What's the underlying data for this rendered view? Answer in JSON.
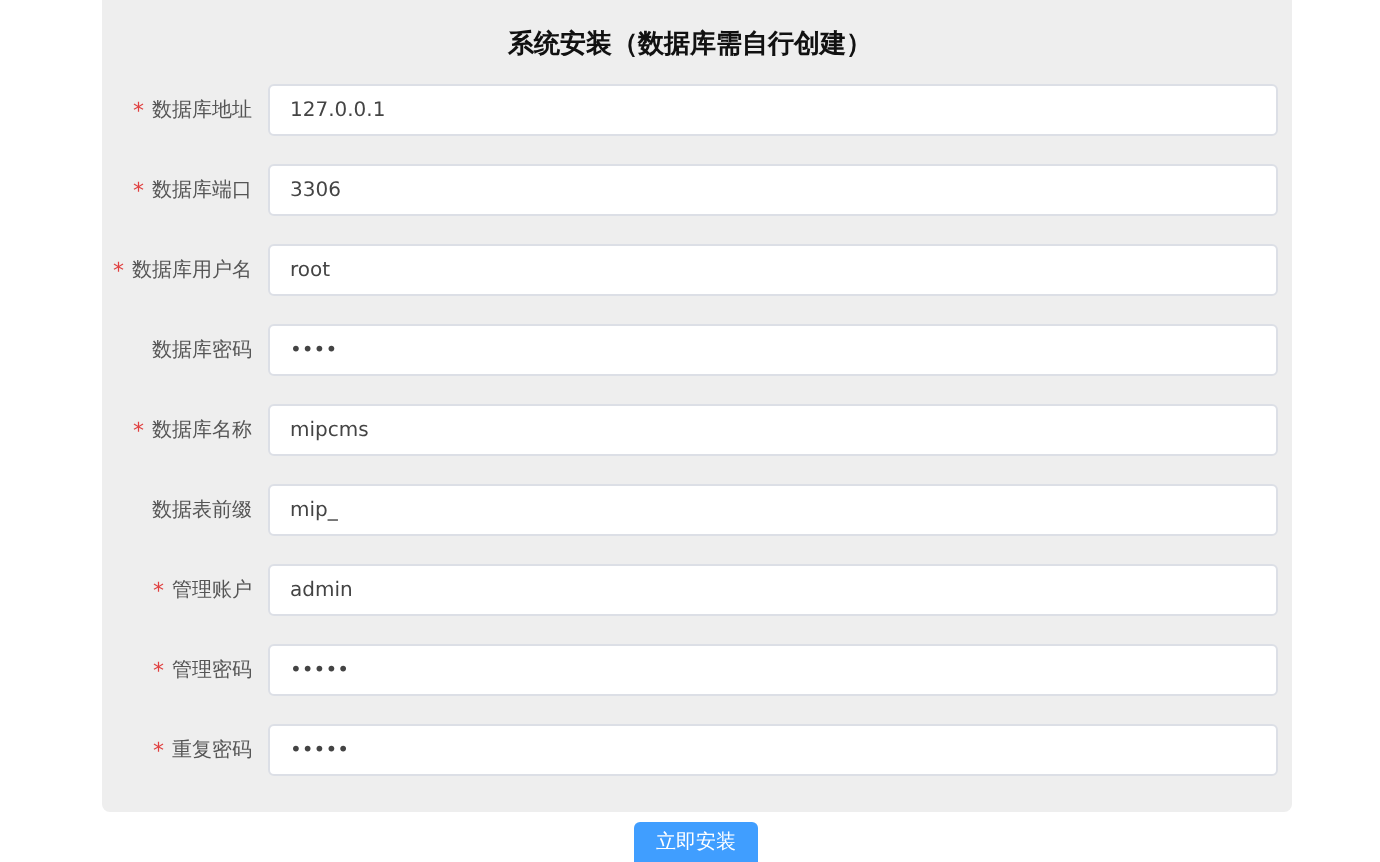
{
  "form": {
    "title": "系统安装（数据库需自行创建）",
    "required_mark": "*",
    "fields": [
      {
        "label": "数据库地址",
        "required": true,
        "value": "127.0.0.1"
      },
      {
        "label": "数据库端口",
        "required": true,
        "value": "3306"
      },
      {
        "label": "数据库用户名",
        "required": true,
        "value": "root"
      },
      {
        "label": "数据库密码",
        "required": false,
        "value": "••••"
      },
      {
        "label": "数据库名称",
        "required": true,
        "value": "mipcms"
      },
      {
        "label": "数据表前缀",
        "required": false,
        "value": "mip_"
      },
      {
        "label": "管理账户",
        "required": true,
        "value": "admin"
      },
      {
        "label": "管理密码",
        "required": true,
        "value": "•••••"
      },
      {
        "label": "重复密码",
        "required": true,
        "value": "•••••"
      }
    ]
  },
  "submit_button": {
    "label": "立即安装"
  }
}
